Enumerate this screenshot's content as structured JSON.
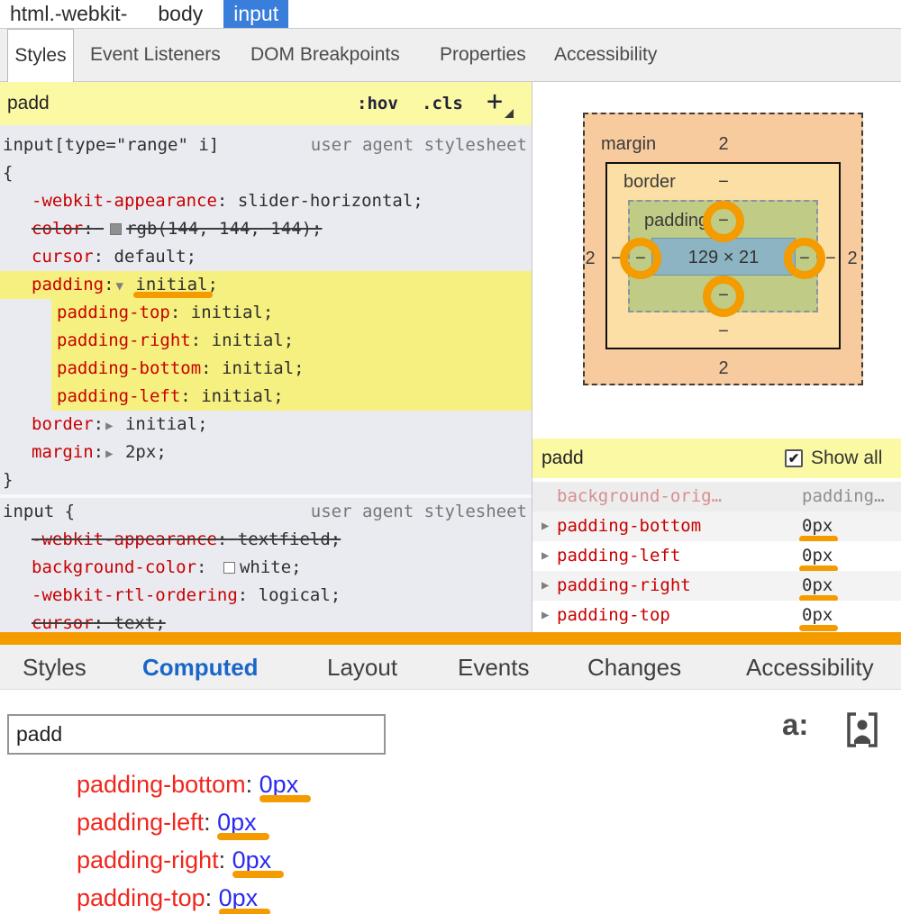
{
  "breadcrumb": {
    "items": [
      {
        "label": "html.-webkit-",
        "selected": false
      },
      {
        "label": "body",
        "selected": false
      },
      {
        "label": "input",
        "selected": true
      }
    ]
  },
  "top_tabs": {
    "items": [
      {
        "label": "Styles",
        "selected": true
      },
      {
        "label": "Event Listeners",
        "selected": false
      },
      {
        "label": "DOM Breakpoints",
        "selected": false
      },
      {
        "label": "Properties",
        "selected": false
      },
      {
        "label": "Accessibility",
        "selected": false
      }
    ]
  },
  "styles_pane": {
    "filter": {
      "query": "padd",
      "hov_label": ":hov",
      "cls_label": ".cls",
      "plus_label": "+"
    },
    "punct": {
      "colon": ":",
      "semicolon": ";"
    },
    "rules": [
      {
        "selector": "input[type=\"range\" i]",
        "origin": "user agent stylesheet",
        "open_brace": "{",
        "close_brace": "}",
        "brace_same_line": false,
        "declarations": [
          {
            "name": "-webkit-appearance",
            "value": "slider-horizontal"
          },
          {
            "name": "color",
            "value": "rgb(144, 144, 144)",
            "struck": true,
            "swatch": "#909090"
          },
          {
            "name": "cursor",
            "value": "default"
          },
          {
            "name": "padding",
            "value": "initial",
            "arrow": "down",
            "highlight": true,
            "orange_underline": true
          },
          {
            "name": "padding-top",
            "value": "initial",
            "sub": true,
            "highlight": true
          },
          {
            "name": "padding-right",
            "value": "initial",
            "sub": true,
            "highlight": true
          },
          {
            "name": "padding-bottom",
            "value": "initial",
            "sub": true,
            "highlight": true
          },
          {
            "name": "padding-left",
            "value": "initial",
            "sub": true,
            "highlight": true
          },
          {
            "name": "border",
            "value": "initial",
            "arrow": "right"
          },
          {
            "name": "margin",
            "value": "2px",
            "arrow": "right"
          }
        ]
      },
      {
        "selector": "input",
        "origin": "user agent stylesheet",
        "open_brace": "{",
        "close_brace": null,
        "brace_same_line": true,
        "declarations": [
          {
            "name": "-webkit-appearance",
            "value": "textfield",
            "struck": true
          },
          {
            "name": "background-color",
            "value": "white",
            "swatch": "#ffffff"
          },
          {
            "name": "-webkit-rtl-ordering",
            "value": "logical"
          },
          {
            "name": "cursor",
            "value": "text",
            "struck": true
          }
        ]
      }
    ]
  },
  "box_model": {
    "margin_label": "margin",
    "border_label": "border",
    "padding_label": "padding",
    "content_size": "129 × 21",
    "margin_top": "2",
    "margin_right": "2",
    "margin_bottom": "2",
    "margin_left": "2",
    "border_top": "−",
    "border_right": "−",
    "border_bottom": "−",
    "border_left": "−",
    "padding_top": "−",
    "padding_right": "−",
    "padding_bottom": "−",
    "padding_left": "−"
  },
  "computed_pane": {
    "filter": "padd",
    "show_all_label": "Show all",
    "show_all_checked": true,
    "rows": [
      {
        "name": "background-orig…",
        "value": "padding…",
        "faded": true,
        "bg": "#ededed",
        "expandable": false,
        "underline": false
      },
      {
        "name": "padding-bottom",
        "value": "0px",
        "faded": false,
        "bg": "#f3f3f3",
        "expandable": true,
        "underline": true
      },
      {
        "name": "padding-left",
        "value": "0px",
        "faded": false,
        "bg": "#ffffff",
        "expandable": true,
        "underline": true
      },
      {
        "name": "padding-right",
        "value": "0px",
        "faded": false,
        "bg": "#f3f3f3",
        "expandable": true,
        "underline": true
      },
      {
        "name": "padding-top",
        "value": "0px",
        "faded": false,
        "bg": "#ffffff",
        "expandable": true,
        "underline": true
      }
    ]
  },
  "bottom_tabs": {
    "items": [
      {
        "label": "Styles",
        "selected": false
      },
      {
        "label": "Computed",
        "selected": true
      },
      {
        "label": "Layout",
        "selected": false
      },
      {
        "label": "Events",
        "selected": false
      },
      {
        "label": "Changes",
        "selected": false
      },
      {
        "label": "Accessibility",
        "selected": false
      }
    ]
  },
  "bottom_panel": {
    "filter_value": "padd",
    "font_icon_label": "a:",
    "rows": [
      {
        "name": "padding-bottom",
        "value": "0px"
      },
      {
        "name": "padding-left",
        "value": "0px"
      },
      {
        "name": "padding-right",
        "value": "0px"
      },
      {
        "name": "padding-top",
        "value": "0px"
      }
    ]
  },
  "colors": {
    "annotation_orange": "#f49b00",
    "breadcrumb_selected_blue": "#3a7edb",
    "computed_tab_blue": "#1a66c9",
    "filter_yellow": "#fbf9a3",
    "highlight_yellow": "#f5f07f",
    "styles_panel_bg": "#e9ebf1",
    "property_red": "#c80000",
    "bottom_property_red": "#f0261d",
    "bottom_value_blue": "#2b2bf0",
    "box_margin": "#f8cb9e",
    "box_border": "#fcdfa4",
    "box_padding": "#c0cc85",
    "box_content": "#8db4c2"
  }
}
